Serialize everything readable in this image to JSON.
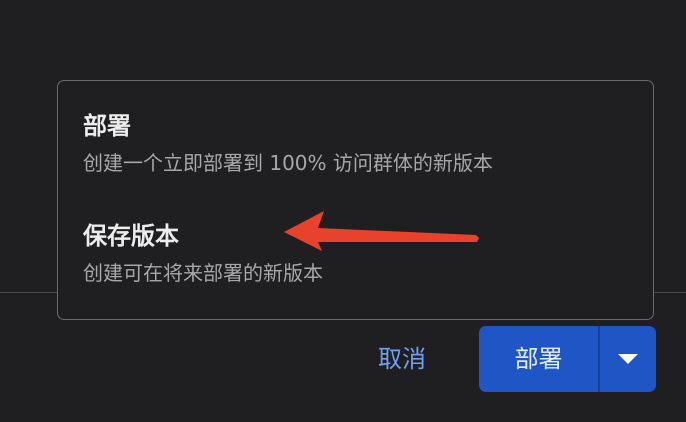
{
  "menu": {
    "options": [
      {
        "title": "部署",
        "description": "创建一个立即部署到 100% 访问群体的新版本"
      },
      {
        "title": "保存版本",
        "description": "创建可在将来部署的新版本"
      }
    ]
  },
  "footer": {
    "cancel_label": "取消",
    "deploy_label": "部署"
  },
  "icons": {
    "annotation_arrow": "red-arrow-icon",
    "dropdown": "caret-down-icon"
  },
  "colors": {
    "background": "#1f1f21",
    "primary_button": "#2055c6",
    "cancel_text": "#6ea0f3",
    "annotation_arrow": "#e8412c"
  }
}
